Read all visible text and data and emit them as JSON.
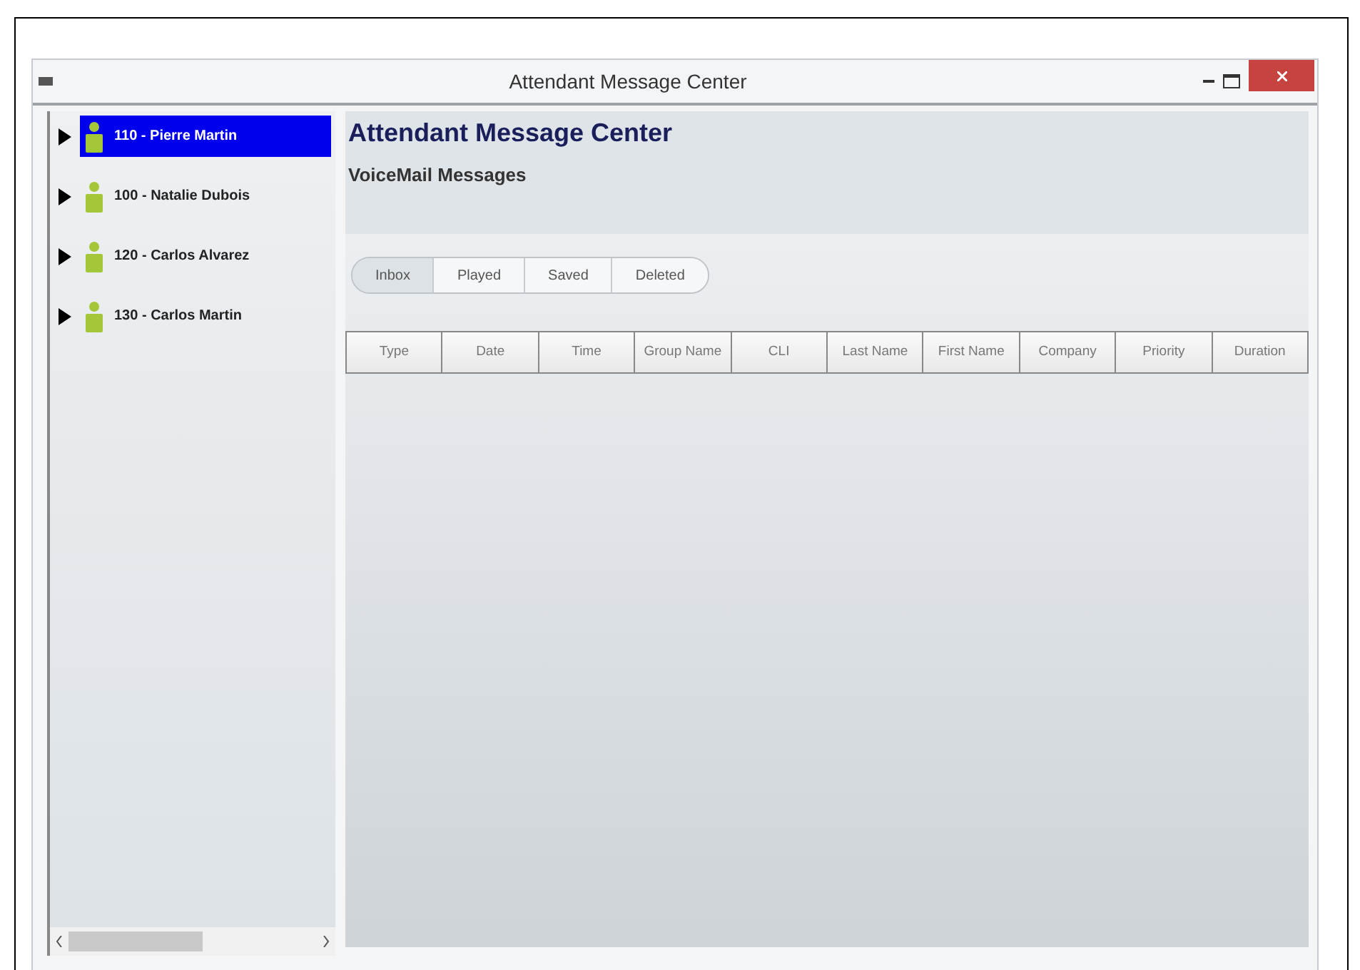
{
  "window": {
    "title": "Attendant Message Center"
  },
  "sidebar": {
    "items": [
      {
        "label": "110 -  Pierre Martin",
        "selected": true
      },
      {
        "label": "100 -  Natalie Dubois",
        "selected": false
      },
      {
        "label": "120 -  Carlos Alvarez",
        "selected": false
      },
      {
        "label": "130 -  Carlos Martin",
        "selected": false
      }
    ]
  },
  "header": {
    "title": "Attendant Message Center",
    "subtitle": "VoiceMail Messages"
  },
  "tabs": [
    {
      "label": "Inbox",
      "selected": true
    },
    {
      "label": "Played",
      "selected": false
    },
    {
      "label": "Saved",
      "selected": false
    },
    {
      "label": "Deleted",
      "selected": false
    }
  ],
  "table": {
    "columns": [
      "Type",
      "Date",
      "Time",
      "Group Name",
      "CLI",
      "Last Name",
      "First Name",
      "Company",
      "Priority",
      "Duration"
    ]
  }
}
